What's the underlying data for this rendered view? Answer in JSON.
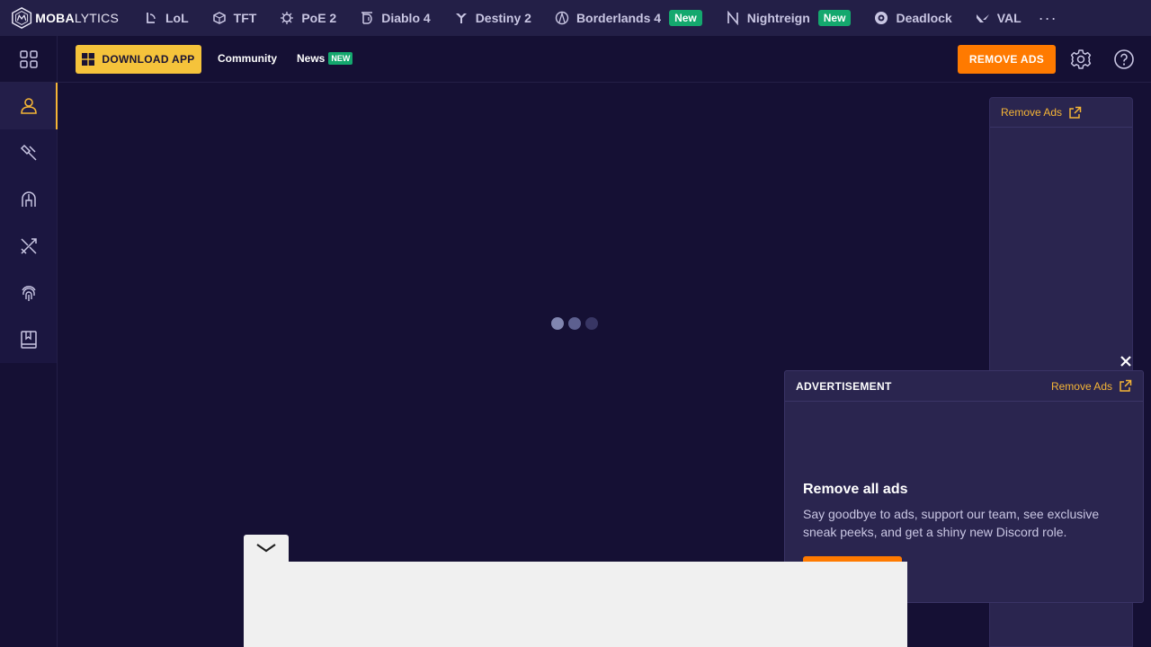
{
  "brand": {
    "bold": "MOBA",
    "light": "LYTICS"
  },
  "games": [
    {
      "label": "LoL",
      "icon": "lol-icon"
    },
    {
      "label": "TFT",
      "icon": "tft-icon"
    },
    {
      "label": "PoE 2",
      "icon": "poe2-icon"
    },
    {
      "label": "Diablo 4",
      "icon": "diablo4-icon"
    },
    {
      "label": "Destiny 2",
      "icon": "destiny2-icon"
    },
    {
      "label": "Borderlands 4",
      "icon": "borderlands4-icon",
      "badge": "New"
    },
    {
      "label": "Nightreign",
      "icon": "nightreign-icon",
      "badge": "New"
    },
    {
      "label": "Deadlock",
      "icon": "deadlock-icon"
    },
    {
      "label": "VAL",
      "icon": "val-icon"
    }
  ],
  "more_label": "···",
  "subheader": {
    "download_label": "DOWNLOAD APP",
    "community_label": "Community",
    "news_label": "News",
    "news_badge": "NEW",
    "remove_ads_label": "REMOVE ADS"
  },
  "sidebar": {
    "items": [
      {
        "icon": "profile-icon",
        "active": true
      },
      {
        "icon": "builds-icon"
      },
      {
        "icon": "champions-icon"
      },
      {
        "icon": "tier-list-icon"
      },
      {
        "icon": "fingerprint-icon"
      },
      {
        "icon": "guides-icon"
      }
    ]
  },
  "right_ad": {
    "remove_ads_link": "Remove Ads"
  },
  "ad_card": {
    "label": "ADVERTISEMENT",
    "remove_ads_link": "Remove Ads",
    "title": "Remove all ads",
    "description": "Say goodbye to ads, support our team, see exclusive sneak peeks, and get a shiny new Discord role."
  },
  "colors": {
    "background": "#151034",
    "topbar": "#231f47",
    "accent_yellow": "#f5c33b",
    "accent_orange": "#ff7a00",
    "badge_green": "#14a86e",
    "link_gold": "#f5b536"
  }
}
